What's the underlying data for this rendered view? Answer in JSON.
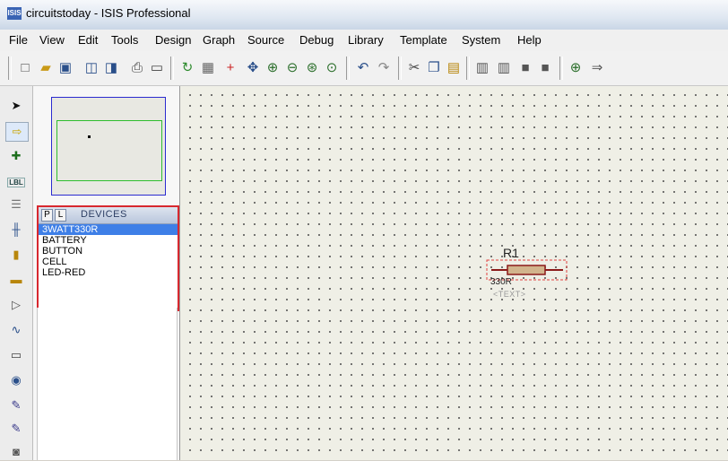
{
  "window": {
    "title": "circuitstoday - ISIS Professional",
    "logo_text": "ISIS"
  },
  "menu": [
    "File",
    "View",
    "Edit",
    "Tools",
    "Design",
    "Graph",
    "Source",
    "Debug",
    "Library",
    "Template",
    "System",
    "Help"
  ],
  "toolbar_icons": [
    "new-file-icon",
    "open-folder-icon",
    "save-icon",
    "import-section-icon",
    "export-section-icon",
    "print-icon",
    "print-area-icon",
    "refresh-icon",
    "toggle-grid-icon",
    "origin-icon",
    "pan-icon",
    "zoom-in-icon",
    "zoom-out-icon",
    "zoom-all-icon",
    "zoom-area-icon",
    "undo-icon",
    "redo-icon",
    "cut-icon",
    "copy-icon",
    "paste-icon",
    "block-copy-icon",
    "block-move-icon",
    "block-rotate-icon",
    "block-delete-icon",
    "pick-device-icon",
    "make-device-icon"
  ],
  "left_tools": [
    "selection-mode-icon",
    "component-mode-icon",
    "junction-dot-icon",
    "wire-label-icon",
    "text-script-icon",
    "buses-icon",
    "subcircuit-icon",
    "terminals-icon",
    "device-pins-icon",
    "graph-mode-icon",
    "tape-recorder-icon",
    "generator-icon",
    "voltage-probe-icon",
    "current-probe-icon",
    "virtual-instruments-icon"
  ],
  "left_tool_label": "LBL",
  "devices": {
    "p_button": "P",
    "l_button": "L",
    "title": "DEVICES",
    "items": [
      "3WATT330R",
      "BATTERY",
      "BUTTON",
      "CELL",
      "LED-RED"
    ],
    "selected_index": 0
  },
  "component": {
    "ref": "R1",
    "value": "330R",
    "text": "<TEXT>"
  },
  "colors": {
    "highlight_box": "#d8282f",
    "selected_item": "#3e7fe7",
    "resistor_body": "#d2b48c",
    "resistor_outline": "#8b1a1a",
    "overview_blue": "#2b2bd0",
    "overview_green": "#2ebd2e",
    "canvas_bg": "#efefe6"
  }
}
